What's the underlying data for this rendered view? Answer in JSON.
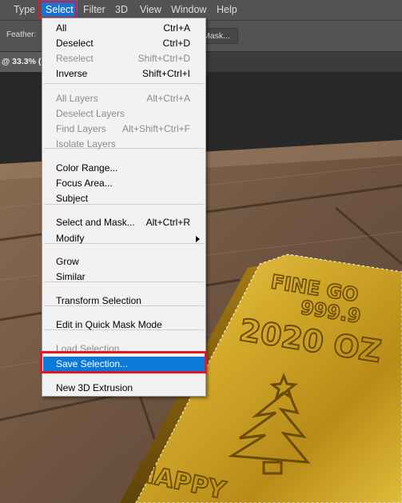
{
  "menubar": {
    "items": [
      {
        "label": "Type"
      },
      {
        "label": "Select"
      },
      {
        "label": "Filter"
      },
      {
        "label": "3D"
      },
      {
        "label": "View"
      },
      {
        "label": "Window"
      },
      {
        "label": "Help"
      }
    ]
  },
  "options_bar": {
    "feather_label": "Feather:",
    "mask_button_label": "Mask..."
  },
  "document": {
    "tab_label": "@ 33.3% ("
  },
  "image_text": {
    "line1": "FINE GO",
    "line2": "999.9",
    "line3": "2020 OZ",
    "line4": "HAPPY"
  },
  "select_menu": {
    "groups": [
      [
        {
          "label": "All",
          "shortcut": "Ctrl+A",
          "enabled": true
        },
        {
          "label": "Deselect",
          "shortcut": "Ctrl+D",
          "enabled": true
        },
        {
          "label": "Reselect",
          "shortcut": "Shift+Ctrl+D",
          "enabled": false
        },
        {
          "label": "Inverse",
          "shortcut": "Shift+Ctrl+I",
          "enabled": true
        }
      ],
      [
        {
          "label": "All Layers",
          "shortcut": "Alt+Ctrl+A",
          "enabled": false
        },
        {
          "label": "Deselect Layers",
          "shortcut": "",
          "enabled": false
        },
        {
          "label": "Find Layers",
          "shortcut": "Alt+Shift+Ctrl+F",
          "enabled": false
        },
        {
          "label": "Isolate Layers",
          "shortcut": "",
          "enabled": false
        }
      ],
      [
        {
          "label": "Color Range...",
          "shortcut": "",
          "enabled": true
        },
        {
          "label": "Focus Area...",
          "shortcut": "",
          "enabled": true
        },
        {
          "label": "Subject",
          "shortcut": "",
          "enabled": true
        }
      ],
      [
        {
          "label": "Select and Mask...",
          "shortcut": "Alt+Ctrl+R",
          "enabled": true
        },
        {
          "label": "Modify",
          "shortcut": "",
          "enabled": true,
          "submenu": true
        }
      ],
      [
        {
          "label": "Grow",
          "shortcut": "",
          "enabled": true
        },
        {
          "label": "Similar",
          "shortcut": "",
          "enabled": true
        }
      ],
      [
        {
          "label": "Transform Selection",
          "shortcut": "",
          "enabled": true
        }
      ],
      [
        {
          "label": "Edit in Quick Mask Mode",
          "shortcut": "",
          "enabled": true
        }
      ],
      [
        {
          "label": "Load Selection...",
          "shortcut": "",
          "enabled": false
        },
        {
          "label": "Save Selection...",
          "shortcut": "",
          "enabled": true,
          "highlighted": true
        }
      ],
      [
        {
          "label": "New 3D Extrusion",
          "shortcut": "",
          "enabled": true
        }
      ]
    ]
  },
  "colors": {
    "menubar_bg": "#535353",
    "menu_highlight": "#0b79d8",
    "annotation_red": "#e0192a",
    "gold": "#c9a227"
  }
}
